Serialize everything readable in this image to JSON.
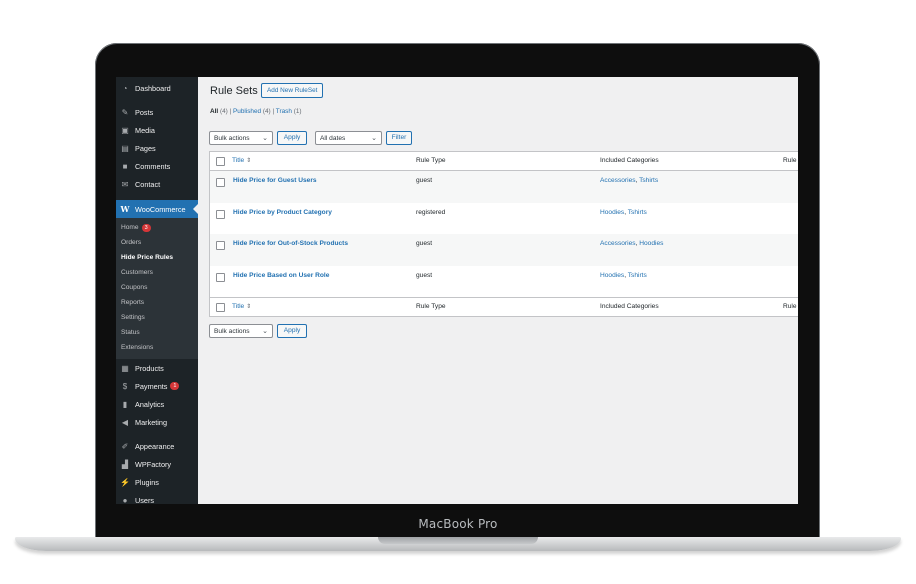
{
  "device": {
    "label": "MacBook Pro"
  },
  "sidebar": {
    "top_items": [
      {
        "label": "Dashboard",
        "icon": "dashboard-icon"
      },
      {
        "label": "Posts",
        "icon": "pin-icon"
      },
      {
        "label": "Media",
        "icon": "media-icon"
      },
      {
        "label": "Pages",
        "icon": "pages-icon"
      },
      {
        "label": "Comments",
        "icon": "comment-icon"
      },
      {
        "label": "Contact",
        "icon": "mail-icon"
      }
    ],
    "woocommerce": {
      "label": "WooCommerce",
      "icon": "woo-icon"
    },
    "sub_items": [
      {
        "label": "Home",
        "badge": "3"
      },
      {
        "label": "Orders"
      },
      {
        "label": "Hide Price Rules",
        "current": true
      },
      {
        "label": "Customers"
      },
      {
        "label": "Coupons"
      },
      {
        "label": "Reports"
      },
      {
        "label": "Settings"
      },
      {
        "label": "Status"
      },
      {
        "label": "Extensions"
      }
    ],
    "bottom_items": [
      {
        "label": "Products",
        "icon": "products-icon"
      },
      {
        "label": "Payments",
        "icon": "payments-icon",
        "badge": "1"
      },
      {
        "label": "Analytics",
        "icon": "analytics-icon"
      },
      {
        "label": "Marketing",
        "icon": "megaphone-icon"
      },
      {
        "label": "Appearance",
        "icon": "brush-icon"
      },
      {
        "label": "WPFactory",
        "icon": "factory-icon"
      },
      {
        "label": "Plugins",
        "icon": "plug-icon"
      },
      {
        "label": "Users",
        "icon": "user-icon"
      }
    ]
  },
  "main": {
    "title": "Rule Sets",
    "add_button": "Add New RuleSet",
    "filters": {
      "all": "All",
      "all_count": "(4)",
      "published": "Published",
      "published_count": "(4)",
      "trash": "Trash",
      "trash_count": "(1)",
      "sep": "|"
    },
    "bulk_select": "Bulk actions",
    "apply": "Apply",
    "dates_select": "All dates",
    "filter": "Filter",
    "columns": {
      "title": "Title",
      "rule_type": "Rule Type",
      "categories": "Included Categories",
      "extra": "Rule"
    },
    "rows": [
      {
        "title": "Hide Price for Guest Users",
        "rule_type": "guest",
        "cat1": "Accessories",
        "cat2": "Tshirts"
      },
      {
        "title": "Hide Price by Product Category",
        "rule_type": "registered",
        "cat1": "Hoodies",
        "cat2": "Tshirts"
      },
      {
        "title": "Hide Price for Out-of-Stock Products",
        "rule_type": "guest",
        "cat1": "Accessories",
        "cat2": "Hoodies"
      },
      {
        "title": "Hide Price Based on User Role",
        "rule_type": "guest",
        "cat1": "Hoodies",
        "cat2": "Tshirts"
      }
    ],
    "bottom_bulk_select": "Bulk actions",
    "bottom_apply": "Apply"
  },
  "colors": {
    "accent": "#2271b1",
    "sidebar_bg": "#1d2327",
    "badge": "#d63638"
  }
}
